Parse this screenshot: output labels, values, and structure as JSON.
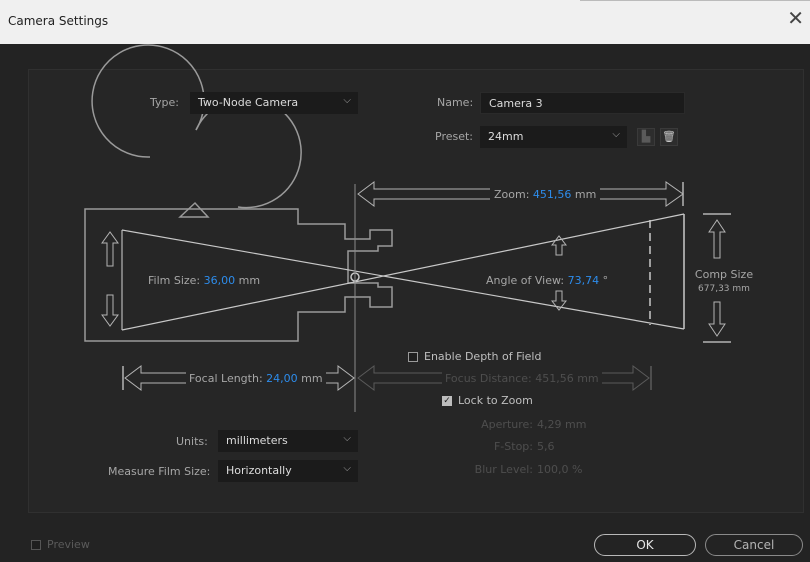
{
  "window": {
    "title": "Camera Settings",
    "close_glyph": "✕"
  },
  "type": {
    "label": "Type:",
    "value": "Two-Node Camera"
  },
  "name": {
    "label": "Name:",
    "value": "Camera 3"
  },
  "preset": {
    "label": "Preset:",
    "value": "24mm",
    "icons": [
      "save-preset-icon",
      "trash-icon"
    ]
  },
  "zoom": {
    "label": "Zoom:",
    "value": "451,56",
    "unit": "mm"
  },
  "film_size": {
    "label": "Film Size:",
    "value": "36,00",
    "unit": "mm"
  },
  "angle_of_view": {
    "label": "Angle of View:",
    "value": "73,74",
    "unit": "°"
  },
  "comp_size": {
    "label": "Comp Size",
    "value": "677,33 mm"
  },
  "focal_length": {
    "label": "Focal Length:",
    "value": "24,00",
    "unit": "mm"
  },
  "depth_of_field": {
    "enable_label": "Enable Depth of Field",
    "enabled": false,
    "focus_distance_label": "Focus Distance:",
    "focus_distance_value": "451,56 mm",
    "lock_to_zoom_label": "Lock to Zoom",
    "lock_to_zoom": true,
    "aperture_label": "Aperture:",
    "aperture_value": "4,29 mm",
    "fstop_label": "F-Stop:",
    "fstop_value": "5,6",
    "blur_label": "Blur Level:",
    "blur_value": "100,0 %"
  },
  "units": {
    "label": "Units:",
    "value": "millimeters"
  },
  "measure_film_size": {
    "label": "Measure Film Size:",
    "value": "Horizontally"
  },
  "footer": {
    "preview_label": "Preview",
    "preview_checked": false,
    "ok_label": "OK",
    "cancel_label": "Cancel"
  },
  "colors": {
    "accent": "#2d8ceb",
    "background": "#232323",
    "diagram_line": "#a0a0a0"
  }
}
